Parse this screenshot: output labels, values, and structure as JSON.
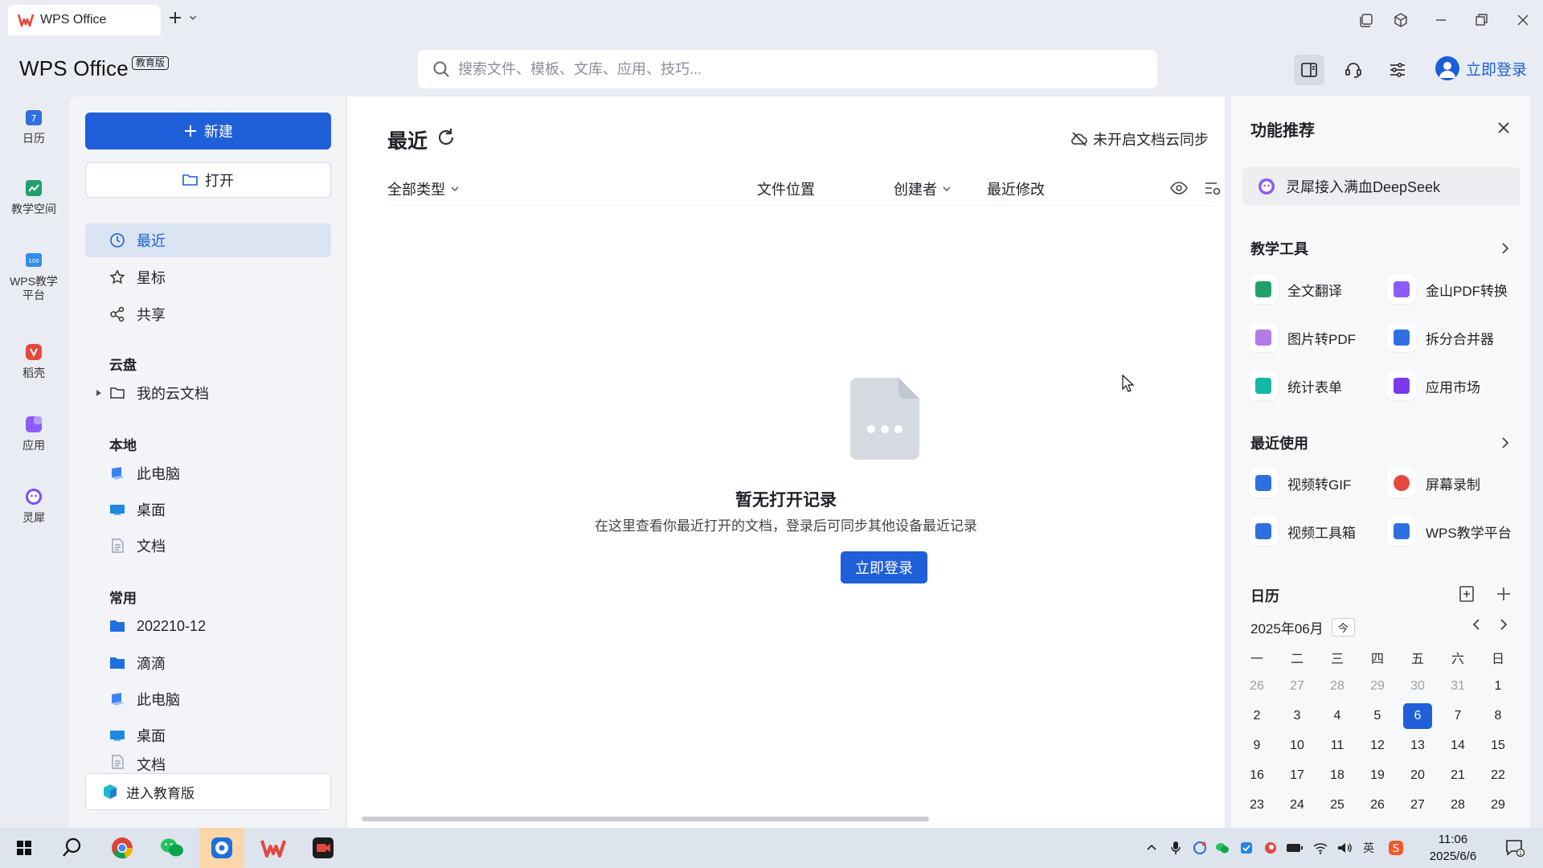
{
  "titlebar": {
    "tab_title": "WPS Office"
  },
  "header": {
    "brand": "WPS Office",
    "badge": "教育版",
    "search_placeholder": "搜索文件、模板、文库、应用、技巧...",
    "login": "立即登录"
  },
  "rail": [
    {
      "label": "日历",
      "icon": "calendar-icon",
      "color": "#2f6fe0"
    },
    {
      "label": "教学空间",
      "icon": "teaching-space-icon",
      "color": "#22a06b"
    },
    {
      "label": "WPS教学\n平台",
      "icon": "teaching-platform-icon",
      "color": "#2f8fe6"
    },
    {
      "label": "稻壳",
      "icon": "docer-icon",
      "color": "#e5483d"
    },
    {
      "label": "应用",
      "icon": "apps-icon",
      "color": "#8b5cf6"
    },
    {
      "label": "灵犀",
      "icon": "lingxi-icon",
      "color": "#7c4dff"
    }
  ],
  "nav": {
    "new_label": "新建",
    "open_label": "打开",
    "items": [
      {
        "label": "最近",
        "icon": "clock-icon",
        "active": true
      },
      {
        "label": "星标",
        "icon": "star-icon"
      },
      {
        "label": "共享",
        "icon": "share-icon"
      }
    ],
    "sections": {
      "cloud": "云盘",
      "local": "本地",
      "common": "常用"
    },
    "cloud_items": [
      {
        "label": "我的云文档",
        "icon": "folder-outline-icon"
      }
    ],
    "local_items": [
      {
        "label": "此电脑",
        "icon": "computer-icon"
      },
      {
        "label": "桌面",
        "icon": "desktop-icon"
      },
      {
        "label": "文档",
        "icon": "document-icon"
      }
    ],
    "common_items": [
      {
        "label": "202210-12",
        "icon": "folder-blue-icon"
      },
      {
        "label": "滴滴",
        "icon": "folder-blue-icon"
      },
      {
        "label": "此电脑",
        "icon": "computer-icon"
      },
      {
        "label": "桌面",
        "icon": "desktop-icon"
      },
      {
        "label": "文档",
        "icon": "document-icon"
      }
    ],
    "edu_label": "进入教育版"
  },
  "main": {
    "title": "最近",
    "sync": "未开启文档云同步",
    "columns": {
      "type": "全部类型",
      "location": "文件位置",
      "creator": "创建者",
      "modified": "最近修改"
    },
    "empty": {
      "title": "暂无打开记录",
      "desc": "在这里查看你最近打开的文档，登录后可同步其他设备最近记录",
      "button": "立即登录"
    }
  },
  "rpanel": {
    "title": "功能推荐",
    "deepseek": "灵犀接入满血DeepSeek",
    "teaching_tools": {
      "title": "教学工具",
      "items": [
        {
          "label": "全文翻译",
          "color": "#22a06b"
        },
        {
          "label": "金山PDF转换",
          "color": "#8b5cf6"
        },
        {
          "label": "图片转PDF",
          "color": "#b07be6"
        },
        {
          "label": "拆分合并器",
          "color": "#2f6fe0"
        },
        {
          "label": "统计表单",
          "color": "#14b8a6"
        },
        {
          "label": "应用市场",
          "color": "#7c3aed"
        }
      ]
    },
    "recent_tools": {
      "title": "最近使用",
      "items": [
        {
          "label": "视频转GIF",
          "color": "#2f6fe0"
        },
        {
          "label": "屏幕录制",
          "color": "#e5483d"
        },
        {
          "label": "视频工具箱",
          "color": "#2f6fe0"
        },
        {
          "label": "WPS教学平台",
          "color": "#2f6fe0"
        }
      ]
    },
    "calendar": {
      "title": "日历",
      "month": "2025年06月",
      "today_btn": "今",
      "weekdays": [
        "一",
        "二",
        "三",
        "四",
        "五",
        "六",
        "日"
      ],
      "weeks": [
        [
          "26",
          "27",
          "28",
          "29",
          "30",
          "31",
          "1"
        ],
        [
          "2",
          "3",
          "4",
          "5",
          "6",
          "7",
          "8"
        ],
        [
          "9",
          "10",
          "11",
          "12",
          "13",
          "14",
          "15"
        ],
        [
          "16",
          "17",
          "18",
          "19",
          "20",
          "21",
          "22"
        ],
        [
          "23",
          "24",
          "25",
          "26",
          "27",
          "28",
          "29"
        ]
      ],
      "today": "6"
    }
  },
  "taskbar": {
    "time": "11:06",
    "date": "2025/6/6",
    "ime": "英"
  },
  "colors": {
    "accent": "#1f5fd9",
    "wps_red": "#e5483d"
  }
}
